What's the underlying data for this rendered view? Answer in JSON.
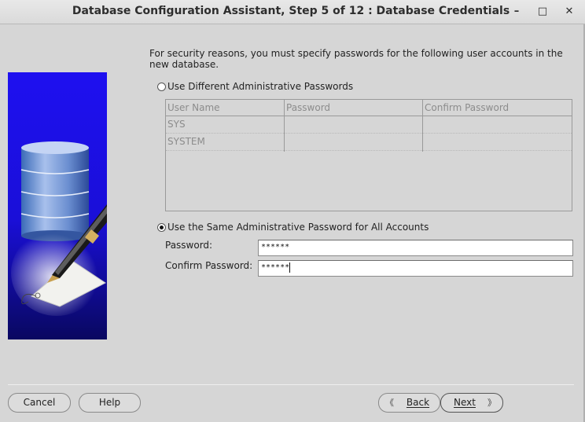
{
  "window": {
    "title": "Database Configuration Assistant, Step 5 of 12 : Database Credentials",
    "min_glyph": "–",
    "max_glyph": "□",
    "close_glyph": "✕"
  },
  "intro_text": "For security reasons, you must specify passwords for the following user accounts in the new database.",
  "options": {
    "different": {
      "label": "Use Different Administrative Passwords",
      "selected": false
    },
    "same": {
      "label": "Use the Same Administrative Password for All Accounts",
      "selected": true
    }
  },
  "accounts_table": {
    "headers": [
      "User Name",
      "Password",
      "Confirm Password"
    ],
    "rows": [
      {
        "user": "SYS",
        "password": "",
        "confirm": ""
      },
      {
        "user": "SYSTEM",
        "password": "",
        "confirm": ""
      }
    ]
  },
  "fields": {
    "password_label": "Password:",
    "password_value": "******",
    "confirm_label": "Confirm Password:",
    "confirm_value": "******"
  },
  "buttons": {
    "cancel": "Cancel",
    "help": "Help",
    "back": "Back",
    "back_arrow": "《",
    "next": "Next",
    "next_arrow": "》"
  },
  "colors": {
    "illustration_blue": "#1a12e8",
    "background": "#d6d6d6"
  }
}
